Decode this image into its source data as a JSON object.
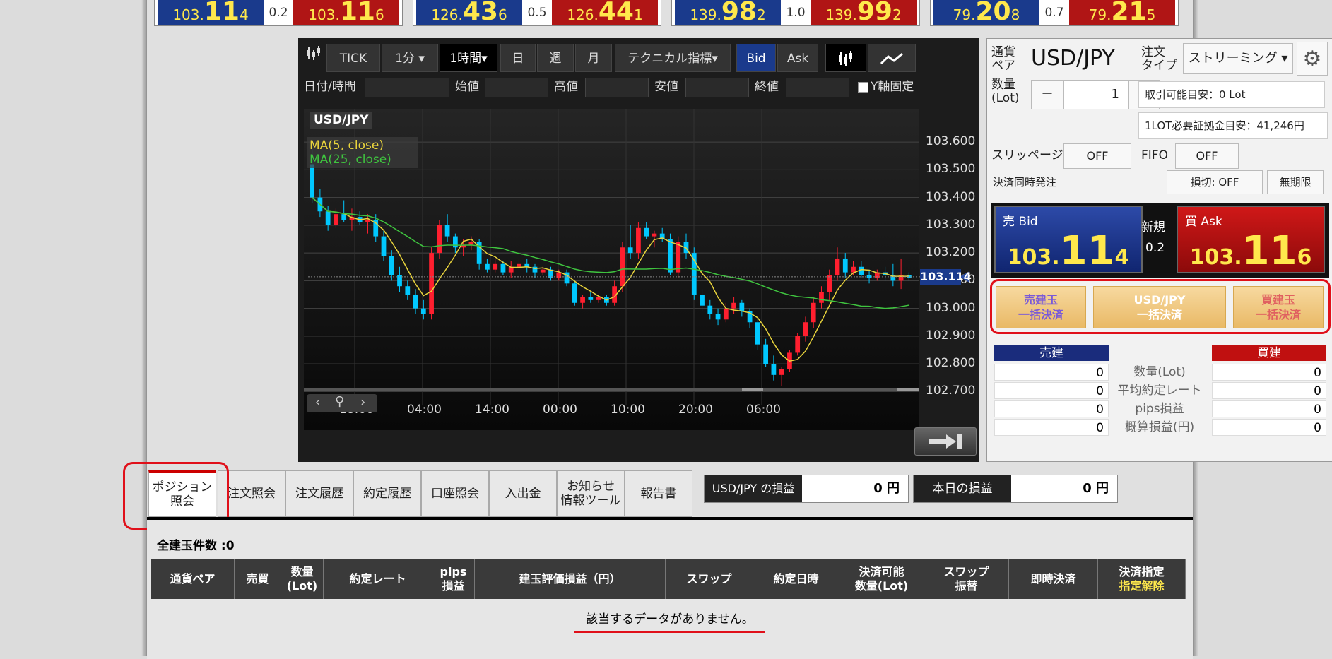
{
  "tickers": [
    {
      "bid_prefix": "103.",
      "bid_big": "11",
      "bid_small": "4",
      "spread": "0.2",
      "ask_prefix": "103.",
      "ask_big": "11",
      "ask_small": "6"
    },
    {
      "bid_prefix": "126.",
      "bid_big": "43",
      "bid_small": "6",
      "spread": "0.5",
      "ask_prefix": "126.",
      "ask_big": "44",
      "ask_small": "1"
    },
    {
      "bid_prefix": "139.",
      "bid_big": "98",
      "bid_small": "2",
      "spread": "1.0",
      "ask_prefix": "139.",
      "ask_big": "99",
      "ask_small": "2"
    },
    {
      "bid_prefix": "79.",
      "bid_big": "20",
      "bid_small": "8",
      "spread": "0.7",
      "ask_prefix": "79.",
      "ask_big": "21",
      "ask_small": "5"
    }
  ],
  "toolbar": {
    "tick": "TICK",
    "min1": "1分 ▾",
    "hour1": "1時間▾",
    "day": "日",
    "week": "週",
    "month": "月",
    "indicators": "テクニカル指標▾",
    "bid": "Bid",
    "ask": "Ask"
  },
  "ohlc": {
    "datetime": "日付/時間",
    "open": "始値",
    "high": "高値",
    "low": "安値",
    "close": "終値",
    "yfix": "Y軸固定"
  },
  "chart_data": {
    "type": "candlestick",
    "symbol": "USD/JPY",
    "legend": [
      "MA(5, close)",
      "MA(25, close)"
    ],
    "y_ticks": [
      "103.600",
      "103.500",
      "103.400",
      "103.300",
      "103.200",
      "103.100",
      "103.000",
      "102.900",
      "102.800",
      "102.700"
    ],
    "x_ticks": [
      "18:00",
      "04:00",
      "14:00",
      "00:00",
      "10:00",
      "20:00",
      "06:00"
    ],
    "current_price": "103.114",
    "ylim": [
      102.65,
      103.72
    ],
    "candles": [
      [
        103.52,
        103.6,
        103.38,
        103.4
      ],
      [
        103.4,
        103.43,
        103.33,
        103.35
      ],
      [
        103.35,
        103.37,
        103.28,
        103.3
      ],
      [
        103.3,
        103.36,
        103.29,
        103.34
      ],
      [
        103.34,
        103.39,
        103.31,
        103.32
      ],
      [
        103.32,
        103.36,
        103.28,
        103.33
      ],
      [
        103.33,
        103.35,
        103.3,
        103.31
      ],
      [
        103.31,
        103.34,
        103.27,
        103.32
      ],
      [
        103.32,
        103.34,
        103.24,
        103.26
      ],
      [
        103.26,
        103.28,
        103.17,
        103.19
      ],
      [
        103.19,
        103.21,
        103.1,
        103.12
      ],
      [
        103.12,
        103.15,
        103.06,
        103.08
      ],
      [
        103.08,
        103.1,
        103.03,
        103.05
      ],
      [
        103.05,
        103.07,
        102.98,
        103.0
      ],
      [
        103.0,
        103.03,
        102.96,
        102.98
      ],
      [
        102.98,
        103.22,
        102.96,
        103.2
      ],
      [
        103.2,
        103.32,
        103.18,
        103.3
      ],
      [
        103.3,
        103.34,
        103.24,
        103.26
      ],
      [
        103.26,
        103.27,
        103.2,
        103.22
      ],
      [
        103.22,
        103.25,
        103.19,
        103.23
      ],
      [
        103.23,
        103.26,
        103.21,
        103.24
      ],
      [
        103.24,
        103.25,
        103.14,
        103.16
      ],
      [
        103.16,
        103.18,
        103.13,
        103.14
      ],
      [
        103.14,
        103.18,
        103.13,
        103.16
      ],
      [
        103.16,
        103.17,
        103.12,
        103.13
      ],
      [
        103.13,
        103.17,
        103.11,
        103.15
      ],
      [
        103.15,
        103.18,
        103.14,
        103.16
      ],
      [
        103.16,
        103.18,
        103.13,
        103.15
      ],
      [
        103.15,
        103.16,
        103.11,
        103.13
      ],
      [
        103.13,
        103.15,
        103.12,
        103.14
      ],
      [
        103.14,
        103.15,
        103.1,
        103.11
      ],
      [
        103.11,
        103.14,
        103.1,
        103.13
      ],
      [
        103.13,
        103.14,
        103.08,
        103.09
      ],
      [
        103.09,
        103.1,
        103.01,
        103.02
      ],
      [
        103.02,
        103.05,
        103.0,
        103.04
      ],
      [
        103.04,
        103.06,
        103.02,
        103.03
      ],
      [
        103.03,
        103.05,
        103.02,
        103.04
      ],
      [
        103.04,
        103.05,
        103.01,
        103.02
      ],
      [
        103.02,
        103.1,
        103.01,
        103.08
      ],
      [
        103.08,
        103.24,
        103.06,
        103.22
      ],
      [
        103.22,
        103.3,
        103.18,
        103.2
      ],
      [
        103.2,
        103.31,
        103.18,
        103.29
      ],
      [
        103.29,
        103.31,
        103.25,
        103.26
      ],
      [
        103.26,
        103.28,
        103.22,
        103.27
      ],
      [
        103.27,
        103.29,
        103.24,
        103.25
      ],
      [
        103.25,
        103.27,
        103.12,
        103.13
      ],
      [
        103.13,
        103.26,
        103.11,
        103.24
      ],
      [
        103.24,
        103.27,
        103.18,
        103.2
      ],
      [
        103.2,
        103.22,
        103.03,
        103.05
      ],
      [
        103.05,
        103.07,
        102.99,
        103.01
      ],
      [
        103.01,
        103.03,
        102.96,
        102.98
      ],
      [
        102.98,
        103.0,
        102.94,
        102.96
      ],
      [
        102.96,
        103.02,
        102.95,
        103.0
      ],
      [
        103.0,
        103.04,
        102.98,
        103.02
      ],
      [
        103.02,
        103.03,
        102.97,
        102.99
      ],
      [
        102.99,
        103.0,
        102.93,
        102.95
      ],
      [
        102.95,
        102.97,
        102.85,
        102.87
      ],
      [
        102.87,
        102.89,
        102.79,
        102.8
      ],
      [
        102.8,
        102.83,
        102.74,
        102.76
      ],
      [
        102.76,
        102.79,
        102.72,
        102.78
      ],
      [
        102.78,
        102.85,
        102.77,
        102.84
      ],
      [
        102.84,
        102.91,
        102.83,
        102.9
      ],
      [
        102.9,
        102.97,
        102.88,
        102.95
      ],
      [
        102.95,
        103.04,
        102.93,
        103.02
      ],
      [
        103.02,
        103.08,
        103.0,
        103.06
      ],
      [
        103.06,
        103.14,
        103.03,
        103.12
      ],
      [
        103.12,
        103.22,
        103.1,
        103.18
      ],
      [
        103.18,
        103.2,
        103.11,
        103.13
      ],
      [
        103.13,
        103.17,
        103.12,
        103.15
      ],
      [
        103.15,
        103.17,
        103.11,
        103.12
      ],
      [
        103.12,
        103.14,
        103.09,
        103.11
      ],
      [
        103.11,
        103.14,
        103.1,
        103.13
      ],
      [
        103.13,
        103.15,
        103.1,
        103.12
      ],
      [
        103.12,
        103.16,
        103.08,
        103.1
      ],
      [
        103.1,
        103.18,
        103.07,
        103.12
      ],
      [
        103.12,
        103.13,
        103.1,
        103.11
      ]
    ]
  },
  "order": {
    "pair_label": "通貨\nペア",
    "pair": "USD/JPY",
    "type_label": "注文\nタイプ",
    "type_value": "ストリーミング ▾",
    "qty_label": "数量\n(Lot)",
    "qty": "1",
    "minus": "－",
    "plus": "＋",
    "avail": "取引可能目安：0 Lot",
    "margin": "1LOT必要証拠金目安：41,246円",
    "slippage_label": "スリッページ",
    "slippage": "OFF",
    "fifo_label": "FIFO",
    "fifo": "OFF",
    "simul_label": "決済同時発注",
    "stop": "損切: OFF",
    "expiry": "無期限",
    "bid_label": "売 Bid",
    "ask_label": "買 Ask",
    "new_label": "新規",
    "spread": "0.2",
    "bid_a": "103.",
    "bid_b": "11",
    "bid_c": "4",
    "ask_a": "103.",
    "ask_b": "11",
    "ask_c": "6",
    "settle_sell": "売建玉\n一括決済",
    "settle_pair": "USD/JPY\n一括決済",
    "settle_buy": "買建玉\n一括決済",
    "sell_head": "売建",
    "buy_head": "買建",
    "rows": [
      {
        "label": "数量(Lot)",
        "sell": "0",
        "buy": "0"
      },
      {
        "label": "平均約定レート",
        "sell": "0",
        "buy": "0"
      },
      {
        "label": "pips損益",
        "sell": "0",
        "buy": "0"
      },
      {
        "label": "概算損益(円)",
        "sell": "0",
        "buy": "0"
      }
    ]
  },
  "tabs": [
    "ポジション\n照会",
    "注文照会",
    "注文履歴",
    "約定履歴",
    "口座照会",
    "入出金",
    "お知らせ\n情報ツール",
    "報告書"
  ],
  "pl": {
    "pair_label": "USD/JPY の損益",
    "pair_value": "0 円",
    "today_label": "本日の損益",
    "today_value": "0 円"
  },
  "positions": {
    "count": "全建玉件数 :0",
    "headers": [
      "通貨ペア",
      "売買",
      "数量\n(Lot)",
      "約定レート",
      "pips\n損益",
      "建玉評価損益（円）",
      "スワップ",
      "約定日時",
      "決済可能\n数量(Lot)",
      "スワップ\n振替",
      "即時決済",
      "決済指定"
    ],
    "sub_header": "指定解除",
    "empty": "該当するデータがありません。"
  }
}
